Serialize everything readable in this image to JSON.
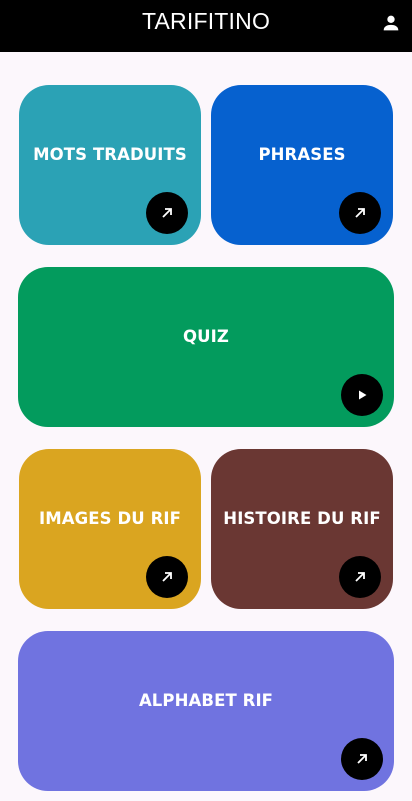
{
  "app": {
    "title": "TARIFITINO"
  },
  "header": {
    "profile_icon": "person-icon"
  },
  "cards": [
    {
      "label": "MOTS TRADUITS",
      "color": "#2ba2b5",
      "icon": "arrow-up-right-icon"
    },
    {
      "label": "PHRASES",
      "color": "#0661cf",
      "icon": "arrow-up-right-icon"
    },
    {
      "label": "QUIZ",
      "color": "#039b5d",
      "icon": "play-icon"
    },
    {
      "label": "IMAGES DU RIF",
      "color": "#daa520",
      "icon": "arrow-up-right-icon"
    },
    {
      "label": "HISTOIRE DU RIF",
      "color": "#6a3733",
      "icon": "arrow-up-right-icon"
    },
    {
      "label": "ALPHABET RIF",
      "color": "#7073e0",
      "icon": "arrow-up-right-icon"
    }
  ]
}
